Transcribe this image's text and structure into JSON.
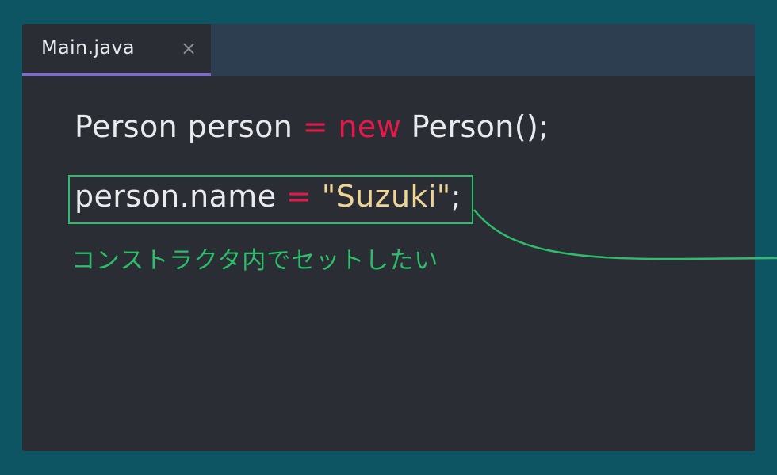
{
  "tab": {
    "label": "Main.java",
    "close_glyph": "×"
  },
  "code": {
    "line1": {
      "type1": "Person",
      "var1": "person",
      "eq": "=",
      "kw_new": "new",
      "ctor": "Person();"
    },
    "line2": {
      "target": "person.name",
      "eq": "=",
      "string": "\"Suzuki\"",
      "semicolon": ";"
    }
  },
  "annotation": {
    "text": "コンストラクタ内でセットしたい"
  },
  "colors": {
    "background": "#0e5563",
    "editor": "#2a2d33",
    "tabbar": "#2c3e50",
    "tab_indicator": "#7e6bc4",
    "keyword": "#e6194b",
    "string": "#efd496",
    "annotation": "#2ebd6b"
  }
}
